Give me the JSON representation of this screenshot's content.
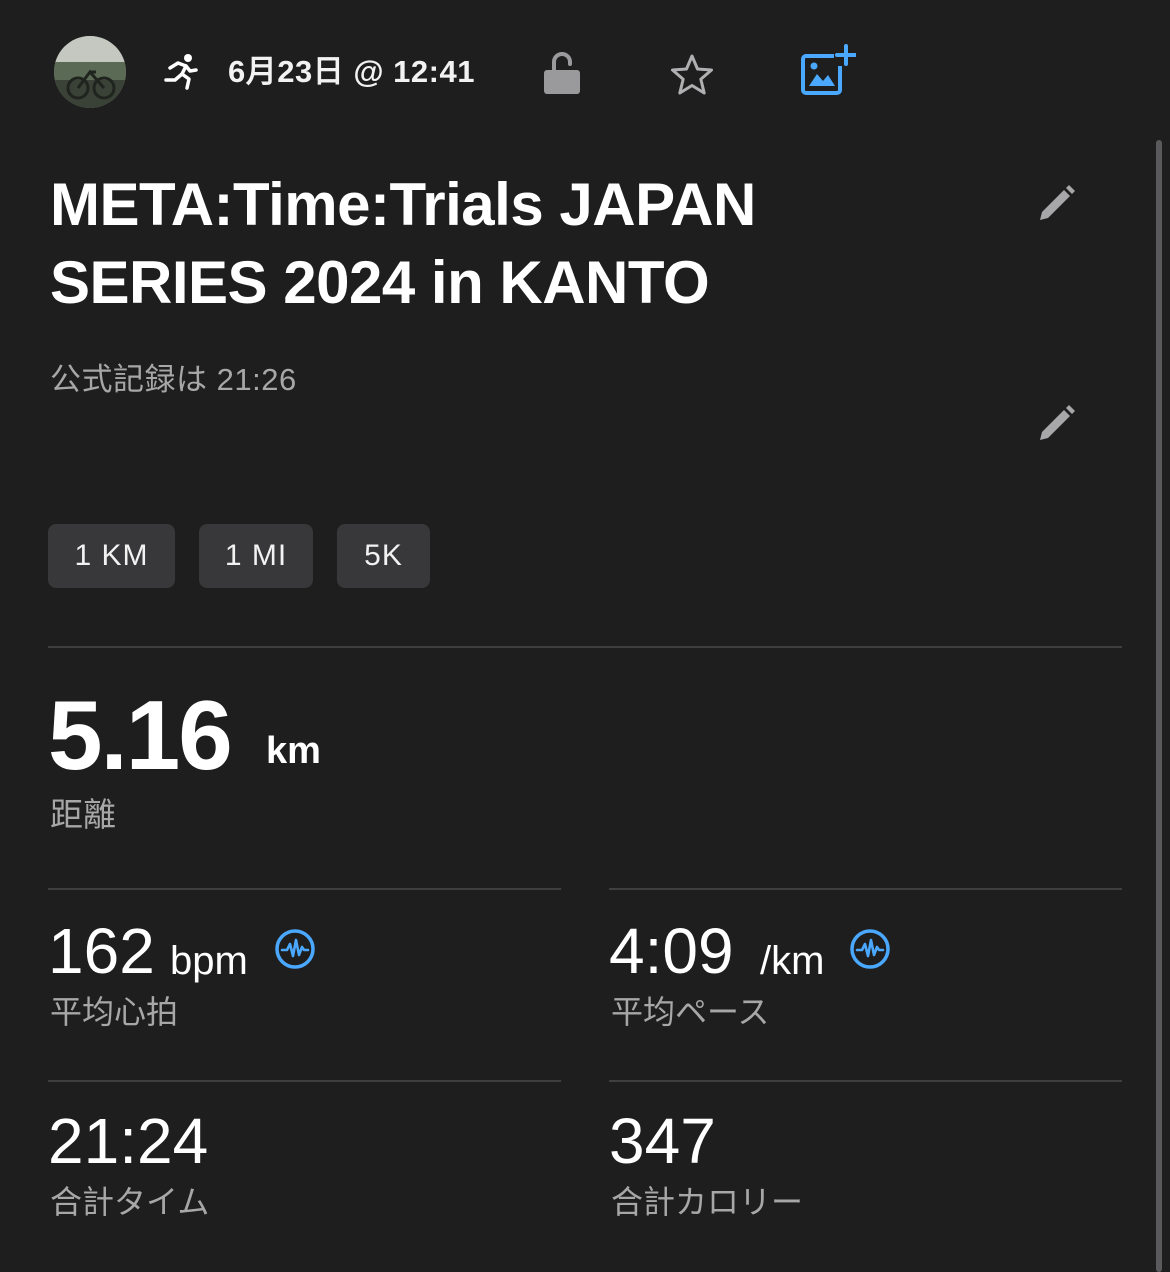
{
  "header": {
    "date_time": "6月23日 @ 12:41",
    "icons": {
      "avatar": "avatar",
      "activity": "running-icon",
      "privacy": "unlock-icon",
      "favorite": "star-icon",
      "add_photo": "add-photo-icon"
    },
    "accent_color": "#4aa8ff"
  },
  "activity": {
    "title_line1": "META:Time:Trials JAPAN",
    "title_line2": "SERIES 2024 in KANTO",
    "description": "公式記録は 21:26"
  },
  "best_efforts": {
    "chips": [
      "1 KM",
      "1 MI",
      "5K"
    ]
  },
  "distance": {
    "value": "5.16",
    "unit": "km",
    "label": "距離"
  },
  "stats": {
    "heart_rate": {
      "value": "162",
      "unit": "bpm",
      "label": "平均心拍"
    },
    "pace": {
      "value": "4:09",
      "unit": "/km",
      "label": "平均ペース"
    },
    "total_time": {
      "value": "21:24",
      "label": "合計タイム"
    },
    "calories": {
      "value": "347",
      "label": "合計カロリー"
    }
  }
}
